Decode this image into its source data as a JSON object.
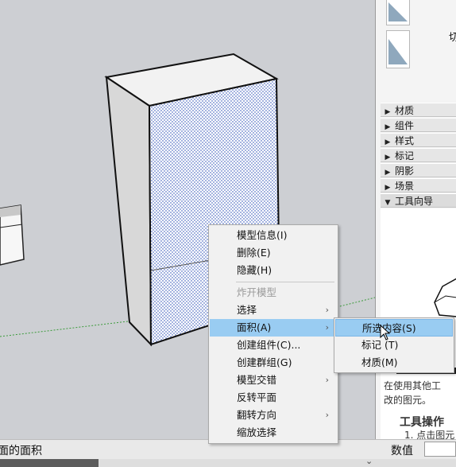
{
  "status_bar": {
    "text": "面的面积",
    "measure_label": "数值",
    "measure_value": ""
  },
  "tray": {
    "cut_label": "切",
    "panels": [
      {
        "label": "材质",
        "expanded": false
      },
      {
        "label": "组件",
        "expanded": false
      },
      {
        "label": "样式",
        "expanded": false
      },
      {
        "label": "标记",
        "expanded": false
      },
      {
        "label": "阴影",
        "expanded": false
      },
      {
        "label": "场景",
        "expanded": false
      },
      {
        "label": "工具向导",
        "expanded": true
      }
    ],
    "help": {
      "partial_line": "在使用其他工",
      "partial_line2": "改的图元。",
      "heading": "工具操作",
      "step1": "1. 点击图元"
    }
  },
  "context_menu": {
    "items": [
      {
        "label": "模型信息(I)",
        "enabled": true
      },
      {
        "label": "删除(E)",
        "enabled": true
      },
      {
        "label": "隐藏(H)",
        "enabled": true
      },
      {
        "label": "炸开模型",
        "enabled": false
      },
      {
        "label": "选择",
        "enabled": true,
        "submenu": true
      },
      {
        "label": "面积(A)",
        "enabled": true,
        "submenu": true,
        "highlighted": true
      },
      {
        "label": "创建组件(C)...",
        "enabled": true
      },
      {
        "label": "创建群组(G)",
        "enabled": true
      },
      {
        "label": "模型交错",
        "enabled": true,
        "submenu": true
      },
      {
        "label": "反转平面",
        "enabled": true
      },
      {
        "label": "翻转方向",
        "enabled": true,
        "submenu": true
      },
      {
        "label": "缩放选择",
        "enabled": true
      }
    ],
    "submenu": {
      "items": [
        {
          "label": "所选内容(S)",
          "highlighted": true
        },
        {
          "label": "标记 (T)"
        },
        {
          "label": "材质(M)"
        }
      ]
    }
  },
  "colors": {
    "viewport_bg": "#cdcfd3",
    "menu_highlight": "#99ccf2",
    "selection_dots": "#1a3fb0",
    "axis_green": "#3a9a3a",
    "axis_red": "#b03030"
  },
  "icons": [
    "submenu-arrow-icon",
    "mouse-cursor-icon",
    "expand-triangle-icon",
    "collapse-triangle-icon"
  ]
}
